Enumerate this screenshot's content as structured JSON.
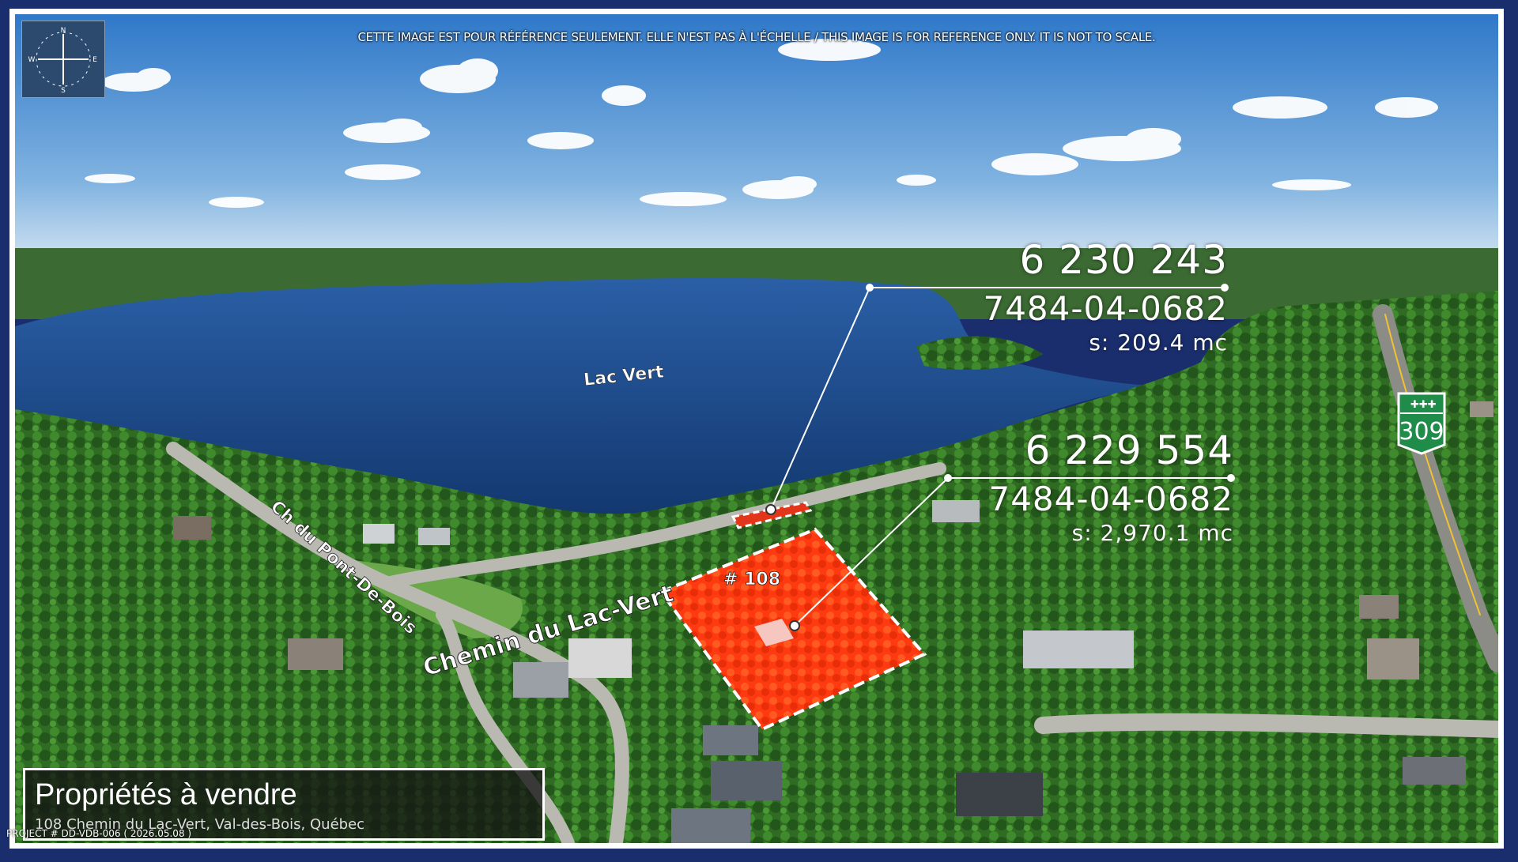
{
  "disclaimer": "CETTE IMAGE EST POUR RÉFÉRENCE SEULEMENT. ELLE N'EST PAS À L'ÉCHELLE / THIS IMAGE IS FOR REFERENCE ONLY. IT IS NOT TO SCALE.",
  "compass": {
    "n": "N",
    "s": "S",
    "e": "E",
    "w": "W"
  },
  "lake_label": "Lac Vert",
  "roads": {
    "pont_de_bois": "Ch du Pont-De-Bois",
    "lac_vert": "Chemin du Lac-Vert"
  },
  "highway_shield": "309",
  "lot_label": "# 108",
  "parcels": [
    {
      "number": "6 230 243",
      "roll": "7484-04-0682",
      "area": "s: 209.4 mc"
    },
    {
      "number": "6 229 554",
      "roll": "7484-04-0682",
      "area": "s: 2,970.1 mc"
    }
  ],
  "info": {
    "title": "Propriétés à vendre",
    "address": "108 Chemin du Lac-Vert, Val-des-Bois, Québec"
  },
  "project": "PROJECT # DD-VDB-006 ( 2026.05.08 )",
  "colors": {
    "sky_top": "#2f78c9",
    "sky_bottom": "#bcd8ee",
    "lake": "#1d4f96",
    "forest": "#2f6b22",
    "parcel_fill": "#ff3a10",
    "shield_green": "#1f8c4a"
  }
}
